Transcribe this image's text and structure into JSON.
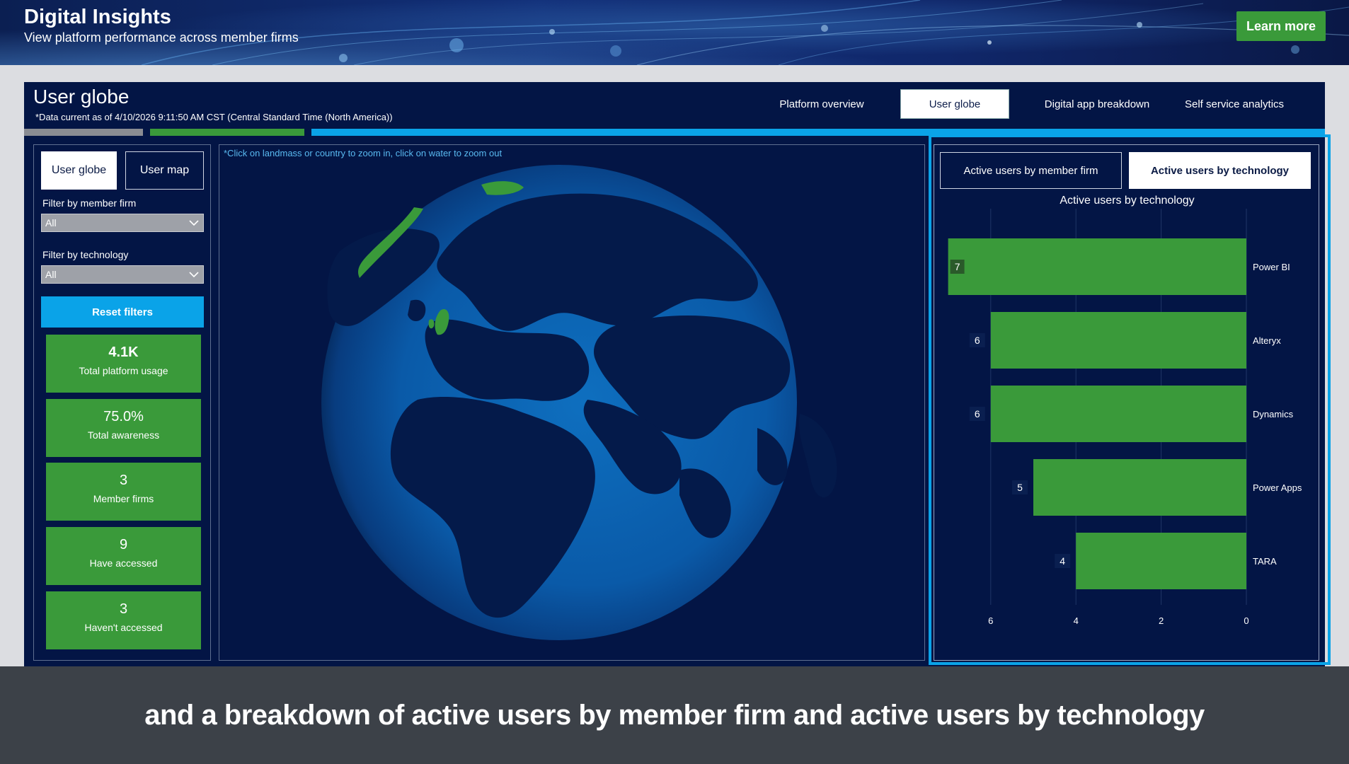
{
  "banner": {
    "title": "Digital Insights",
    "subtitle": "View platform performance across member firms",
    "learn_more": "Learn more"
  },
  "report": {
    "title": "User globe",
    "data_note": "*Data current as of 4/10/2026 9:11:50 AM CST (Central Standard Time (North America))",
    "nav": [
      "Platform overview",
      "User globe",
      "Digital app breakdown",
      "Self service analytics"
    ],
    "active_nav": "User globe"
  },
  "left_panel": {
    "tabs": [
      "User globe",
      "User map"
    ],
    "filter_member_firm_label": "Filter by member firm",
    "filter_member_firm_value": "All",
    "filter_technology_label": "Filter by technology",
    "filter_technology_value": "All",
    "reset_label": "Reset filters",
    "kpis": [
      {
        "value": "4.1K",
        "label": "Total platform usage"
      },
      {
        "value": "75.0%",
        "label": "Total awareness"
      },
      {
        "value": "3",
        "label": "Member firms"
      },
      {
        "value": "9",
        "label": "Have accessed"
      },
      {
        "value": "3",
        "label": "Haven't accessed"
      }
    ]
  },
  "globe": {
    "hint": "*Click on landmass or country to zoom in, click on water to zoom out"
  },
  "right_panel": {
    "tabs": [
      "Active users by member firm",
      "Active users by technology"
    ],
    "active_tab": "Active users by technology"
  },
  "colors": {
    "accent_green": "#3a9a3a",
    "accent_blue": "#0aa3e8",
    "report_bg": "#031545"
  },
  "caption": "and a breakdown of active users by member firm and active users by technology",
  "chart_data": {
    "type": "bar",
    "orientation": "horizontal",
    "title": "Active users by technology",
    "categories": [
      "Power BI",
      "Alteryx",
      "Dynamics",
      "Power Apps",
      "TARA"
    ],
    "values": [
      7,
      6,
      6,
      5,
      4
    ],
    "x_axis_reversed": true,
    "ticks": [
      6,
      4,
      2,
      0
    ],
    "xlim": [
      0,
      7
    ],
    "grid": true,
    "bar_color": "#3a9a3a"
  }
}
